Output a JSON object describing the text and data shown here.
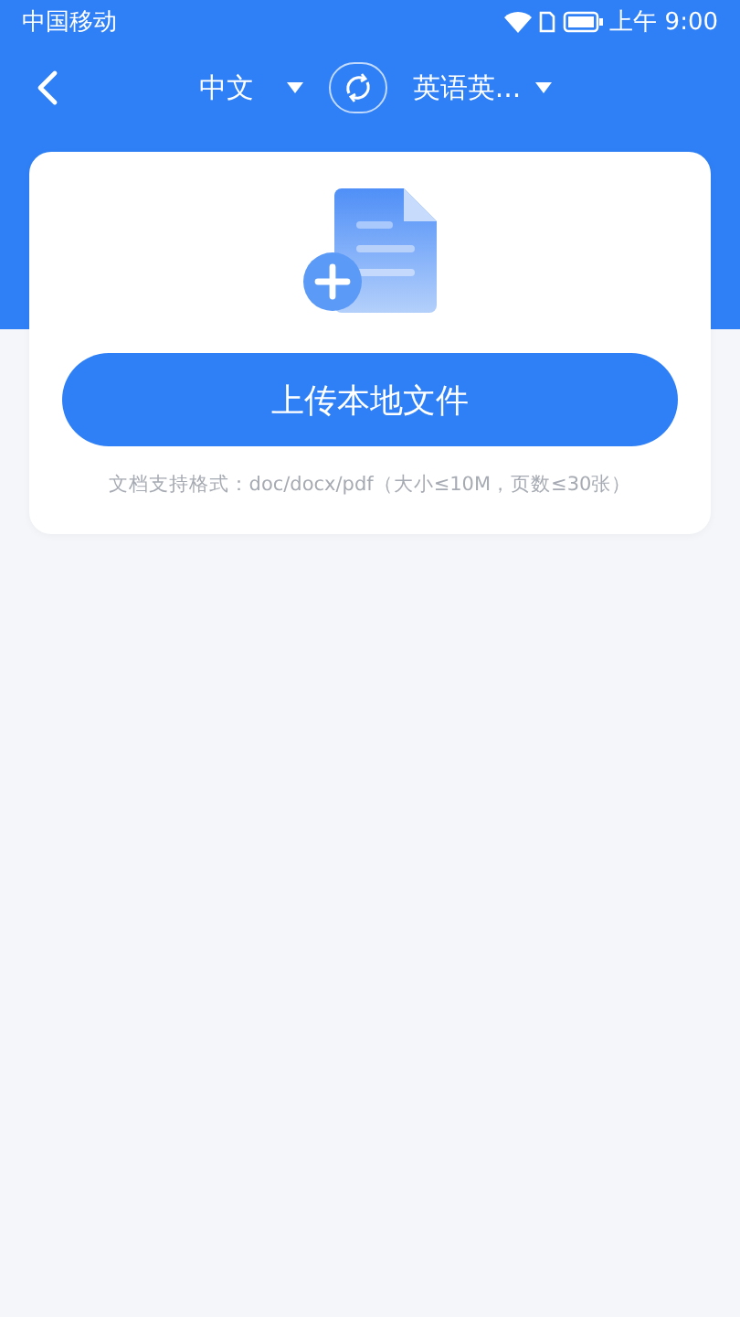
{
  "status_bar": {
    "carrier": "中国移动",
    "time": "上午 9:00"
  },
  "nav": {
    "source_language": "中文",
    "target_language": "英语英..."
  },
  "upload": {
    "button": "上传本地文件",
    "hint": "文档支持格式：doc/docx/pdf（大小≤10M，页数≤30张）"
  }
}
